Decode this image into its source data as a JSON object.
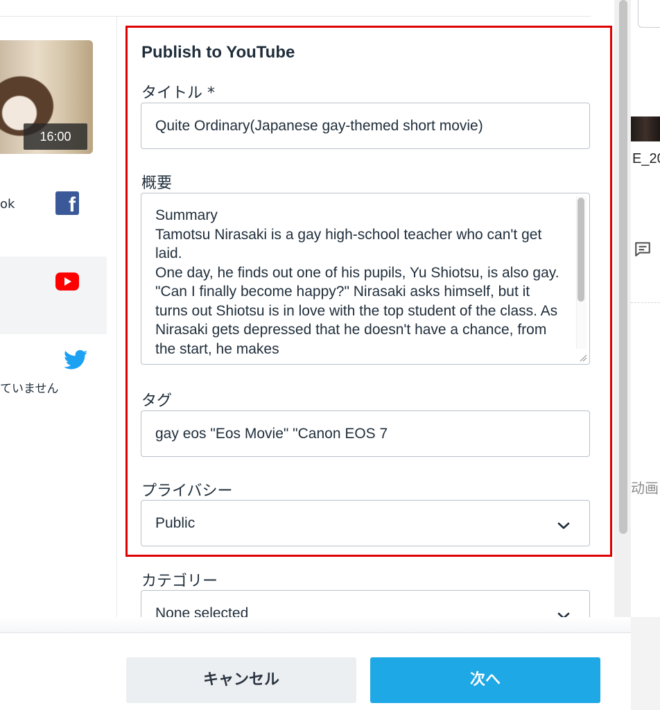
{
  "background": {
    "partial_text_1": "E_20",
    "partial_text_2": "动画"
  },
  "left": {
    "video_duration": "16:00",
    "networks": [
      {
        "label": "ok",
        "icon": "facebook-icon"
      },
      {
        "label": "",
        "icon": "youtube-icon",
        "selected": true
      },
      {
        "label": "",
        "icon": "twitter-icon",
        "status": "ていません"
      }
    ]
  },
  "form": {
    "title": "Publish to YouTube",
    "title_label": "タイトル *",
    "title_value": "Quite Ordinary(Japanese gay-themed short movie)",
    "summary_label": "概要",
    "summary_value": "Summary\nTamotsu Nirasaki is a gay high-school teacher who can't get laid.\nOne day, he finds out one of his pupils, Yu Shiotsu, is also gay.\n\"Can I finally become happy?\" Nirasaki asks himself, but it turns out Shiotsu is in love with the top student of the class. As Nirasaki gets depressed that he doesn't have a chance, from the start, he makes",
    "tags_label": "タグ",
    "tags_value": "gay eos \"Eos Movie\" \"Canon EOS 7",
    "privacy_label": "プライバシー",
    "privacy_value": "Public",
    "category_label": "カテゴリー",
    "category_value": "None selected"
  },
  "footer": {
    "cancel_label": "キャンセル",
    "next_label": "次へ"
  },
  "colors": {
    "highlight_frame": "#e00000",
    "primary_button": "#1fa8e6",
    "facebook": "#3b5998",
    "youtube": "#ff0000",
    "twitter": "#1da1f2"
  }
}
